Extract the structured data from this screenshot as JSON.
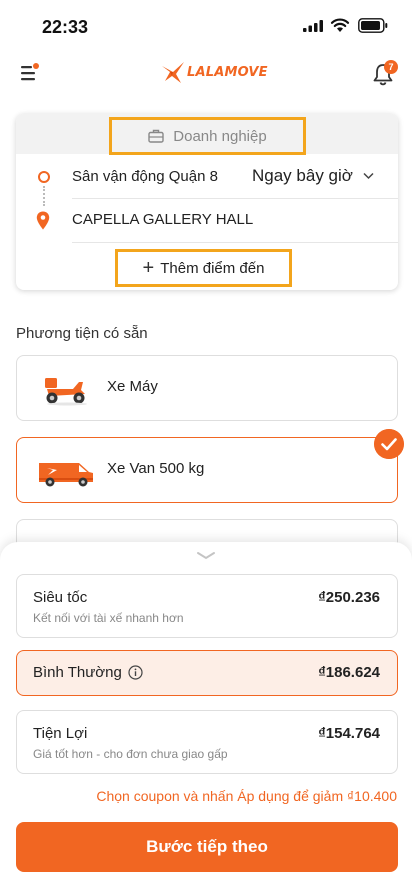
{
  "status_bar": {
    "time": "22:33",
    "icons": [
      "signal-icon",
      "wifi-icon",
      "battery-icon"
    ]
  },
  "header": {
    "logo_text": "LALAMOVE",
    "notification_count": "7",
    "icons": [
      "menu-icon",
      "bell-icon"
    ]
  },
  "route": {
    "tab_label": "Doanh nghiệp",
    "pickup": "Sân vận động Quận 8",
    "time_option": "Ngay bây giờ",
    "dropoff": "CAPELLA GALLERY HALL",
    "add_stop_label": "Thêm điểm đến"
  },
  "vehicles": {
    "section_title": "Phương tiện có sẵn",
    "items": [
      {
        "name": "Xe Máy",
        "selected": false
      },
      {
        "name": "Xe Van 500 kg",
        "selected": true
      }
    ]
  },
  "fares": {
    "items": [
      {
        "name": "Siêu tốc",
        "subtitle": "Kết nối với tài xế nhanh hơn",
        "price": "₫250.236",
        "selected": false
      },
      {
        "name": "Bình Thường",
        "subtitle": "",
        "price": "₫186.624",
        "selected": true
      },
      {
        "name": "Tiện Lợi",
        "subtitle": "Giá tốt hơn - cho đơn chưa giao gấp",
        "price": "₫154.764",
        "selected": false
      }
    ],
    "coupon_note": "Chọn coupon và nhấn Áp dụng để giảm ₫10.400"
  },
  "footer": {
    "next_button": "Bước tiếp theo"
  },
  "colors": {
    "accent": "#f16622",
    "highlight_border": "#f3a51c",
    "selected_fare_bg": "#fdeee6"
  }
}
